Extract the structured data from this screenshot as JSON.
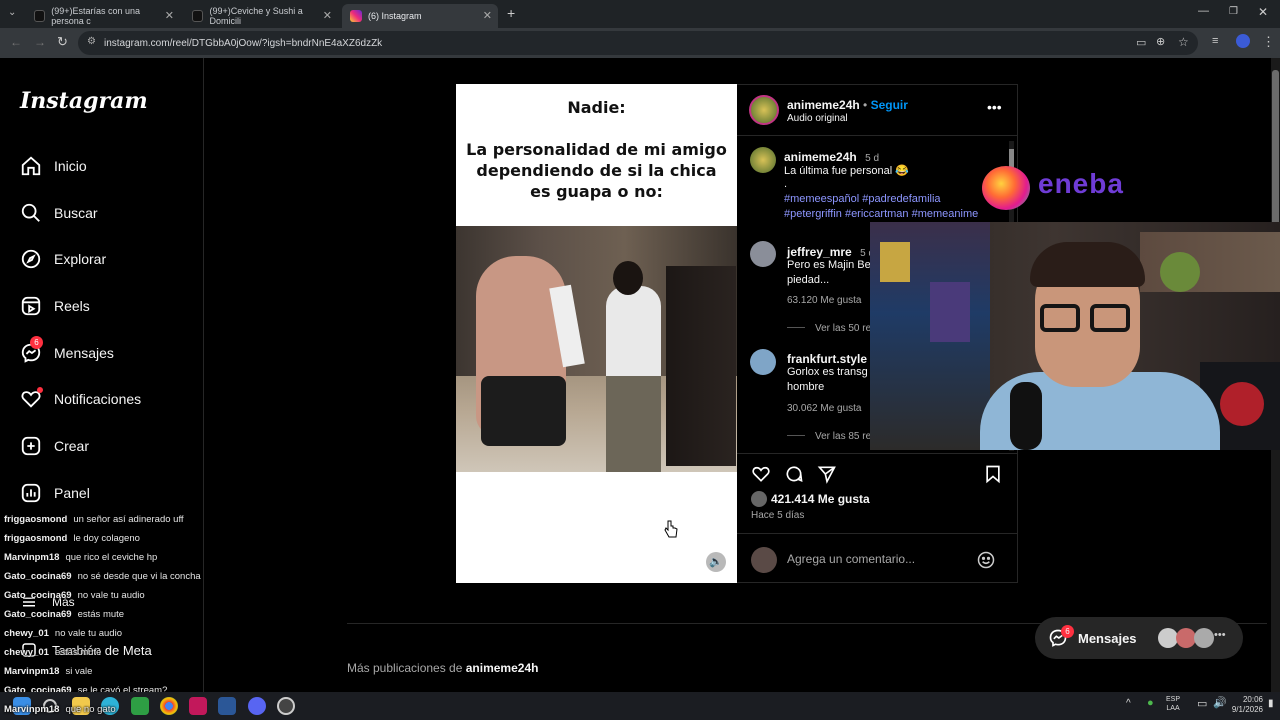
{
  "browser": {
    "tabs": [
      {
        "label": "(99+)Estarías con una persona c"
      },
      {
        "label": "(99+)Ceviche y Sushi a Domicili"
      },
      {
        "label": "(6) Instagram"
      }
    ],
    "url": "instagram.com/reel/DTGbbA0jOow/?igsh=bndrNnE4aXZ6dzZk"
  },
  "sidebar": {
    "logo": "Instagram",
    "items": [
      {
        "label": "Inicio"
      },
      {
        "label": "Buscar"
      },
      {
        "label": "Explorar"
      },
      {
        "label": "Reels"
      },
      {
        "label": "Mensajes",
        "badge": "6"
      },
      {
        "label": "Notificaciones"
      },
      {
        "label": "Crear"
      },
      {
        "label": "Panel"
      },
      {
        "label": "Más"
      },
      {
        "label": "También de Meta"
      }
    ]
  },
  "post": {
    "meme_heading": "Nadie:",
    "meme_text_1": "La personalidad de mi amigo",
    "meme_text_2": "dependiendo de si la chica",
    "meme_text_3": "es guapa o no:",
    "author": "animeme24h",
    "follow": "Seguir",
    "audio": "Audio original",
    "caption": {
      "user": "animeme24h",
      "time": "5 d",
      "text": "La última fue personal 😂",
      "dot": ".",
      "tags_1": "#memeespañol #padredefamilia",
      "tags_2": "#petergriffin #ericcartman #memeanime"
    },
    "comments": [
      {
        "user": "jeffrey_mre",
        "time": "5 d",
        "text_1": "Pero es Majin Be",
        "text_2": "piedad...",
        "likes": "63.120 Me gusta",
        "replies": "Ver las 50 re"
      },
      {
        "user": "frankfurt.style",
        "time": "5",
        "text_1": "Gorlox es transg",
        "text_2": "hombre",
        "likes": "30.062 Me gusta",
        "replies": "Ver las 85 re"
      }
    ],
    "likes": "421.414 Me gusta",
    "date": "Hace 5 días",
    "comment_placeholder": "Agrega un comentario..."
  },
  "more_posts": {
    "prefix": "Más publicaciones de",
    "user": "animeme24h"
  },
  "messages_float": {
    "label": "Mensajes",
    "badge": "6"
  },
  "overlay": {
    "brand": "eneba"
  },
  "chat": [
    {
      "user": "friggaosmond",
      "msg": "un señor así adinerado uff"
    },
    {
      "user": "friggaosmond",
      "msg": "le doy colageno"
    },
    {
      "user": "Marvinpm18",
      "msg": "que rico el ceviche hp"
    },
    {
      "user": "Gato_cocina69",
      "msg": "no sé desde que vi la concha"
    },
    {
      "user": "Gato_cocina69",
      "msg": "no vale tu audio"
    },
    {
      "user": "Gato_cocina69",
      "msg": "estás mute"
    },
    {
      "user": "chewy_01",
      "msg": "no vale tu audio"
    },
    {
      "user": "chewy_01",
      "msg": "estas mute"
    },
    {
      "user": "Marvinpm18",
      "msg": "si vale"
    },
    {
      "user": "Gato_cocina69",
      "msg": "se le cayó el stream?"
    },
    {
      "user": "Marvinpm18",
      "msg": "que no gato"
    }
  ],
  "taskbar": {
    "lang_1": "ESP",
    "lang_2": "LAA",
    "time": "20:06",
    "date": "9/1/2026"
  }
}
